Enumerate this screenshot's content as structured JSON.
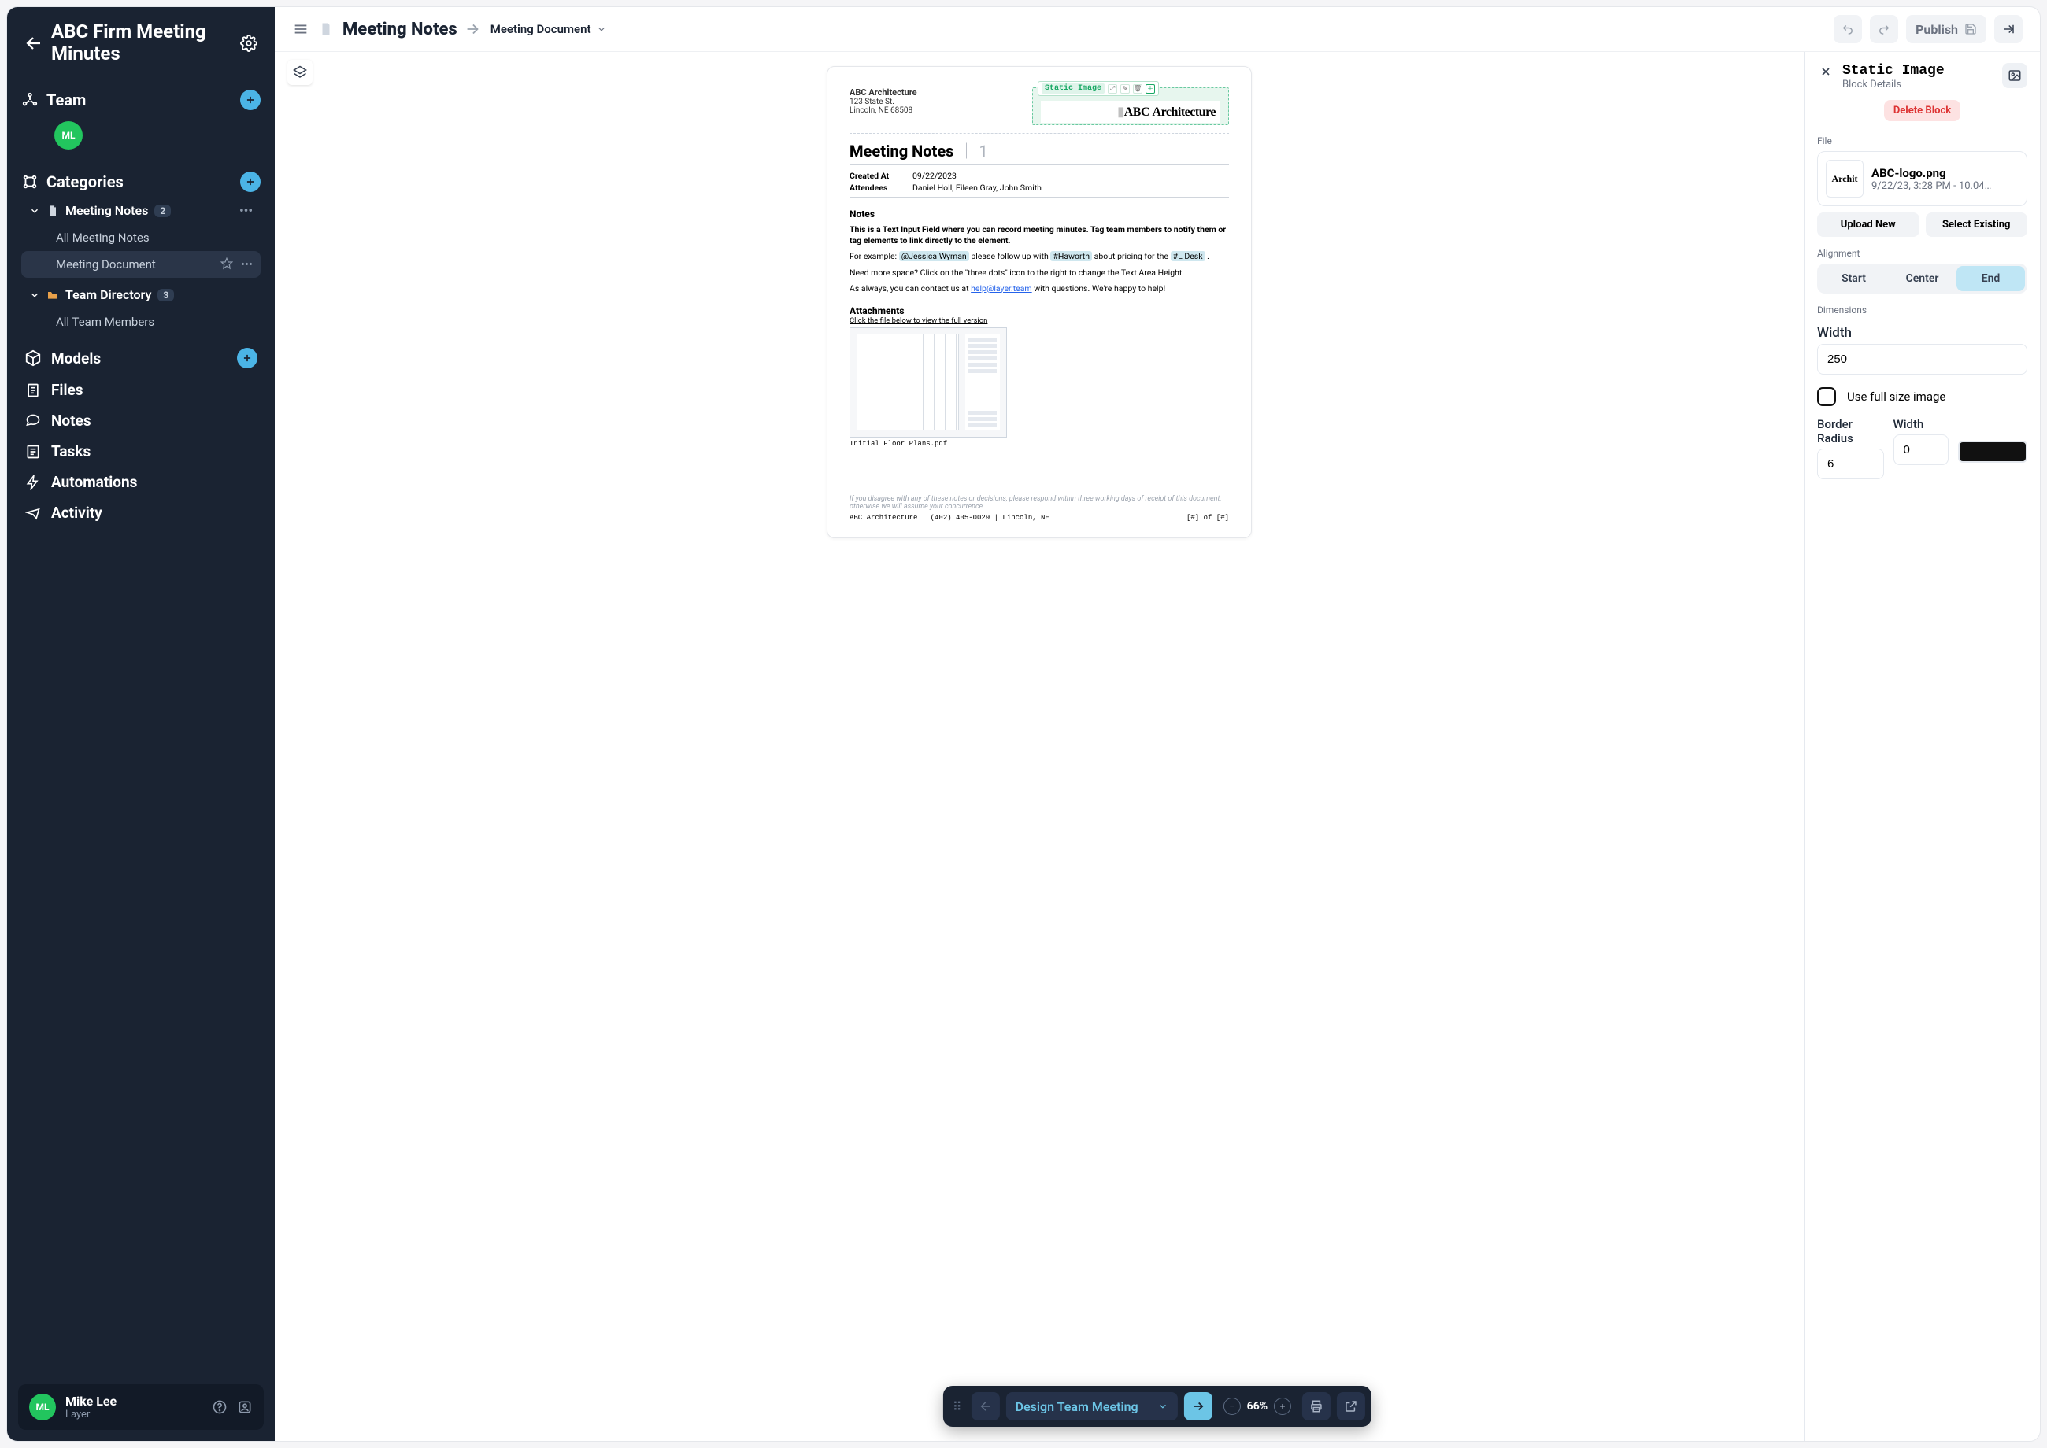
{
  "project": {
    "title": "ABC Firm Meeting Minutes"
  },
  "sidebar": {
    "team": {
      "label": "Team",
      "avatar_initials": "ML"
    },
    "categories": {
      "label": "Categories",
      "meeting_notes": {
        "label": "Meeting Notes",
        "count": "2"
      },
      "all_meeting_notes": "All Meeting Notes",
      "meeting_document": "Meeting Document",
      "team_directory": {
        "label": "Team Directory",
        "count": "3"
      },
      "all_team_members": "All Team Members"
    },
    "models": "Models",
    "files": "Files",
    "notes": "Notes",
    "tasks": "Tasks",
    "automations": "Automations",
    "activity": "Activity"
  },
  "user": {
    "name": "Mike Lee",
    "org": "Layer",
    "initials": "ML"
  },
  "topbar": {
    "title": "Meeting Notes",
    "breadcrumb": "Meeting Document",
    "publish": "Publish"
  },
  "document": {
    "firm": "ABC Architecture",
    "addr1": "123 State St.",
    "addr2": "Lincoln, NE 68508",
    "logo_label": "Static Image",
    "logo_text_prefix": "ABC ",
    "logo_text_main": "Architecture",
    "title": "Meeting Notes",
    "title_num": "1",
    "created_at_label": "Created At",
    "created_at": "09/22/2023",
    "attendees_label": "Attendees",
    "attendees": "Daniel Holl, Eileen Gray, John Smith",
    "notes_h": "Notes",
    "intro": "This is a Text Input Field where you can record meeting minutes. Tag team members to notify them or tag elements to link directly to the element.",
    "example_prefix": "For example: ",
    "mention": "@Jessica Wyman",
    "example_mid1": " please follow up with ",
    "hash1": "#Haworth",
    "example_mid2": " about pricing for the ",
    "hash2": "#L Desk",
    "example_end": " .",
    "line3": "Need more space? Click on the \"three dots\" icon to the right to change the Text Area Height.",
    "line4a": "As always, you can contact us at ",
    "email": "help@layer.team",
    "line4b": " with questions. We're happy to help!",
    "attach_h": "Attachments",
    "attach_sub": "Click the file below to view the full version",
    "attach_name": "Initial Floor Plans.pdf",
    "disclaimer": "If you disagree with any of these notes or decisions, please respond within three working days of receipt of this document; otherwise we will assume your concurrence.",
    "footer_left": "ABC Architecture | (402) 405-0029 | Lincoln, NE",
    "footer_right": "[#] of [#]"
  },
  "inspector": {
    "title": "Static Image",
    "subtitle": "Block Details",
    "delete": "Delete Block",
    "file_label": "File",
    "file_name": "ABC-logo.png",
    "file_meta": "9/22/23, 3:28 PM - 10.04…",
    "upload": "Upload New",
    "select_existing": "Select Existing",
    "alignment_label": "Alignment",
    "align_start": "Start",
    "align_center": "Center",
    "align_end": "End",
    "dimensions_label": "Dimensions",
    "width_label": "Width",
    "width_value": "250",
    "fullsize": "Use full size image",
    "border_radius_label": "Border Radius",
    "border_radius_value": "6",
    "width2_label": "Width",
    "width2_value": "0"
  },
  "floatbar": {
    "label": "Design Team Meeting",
    "zoom": "66%"
  }
}
